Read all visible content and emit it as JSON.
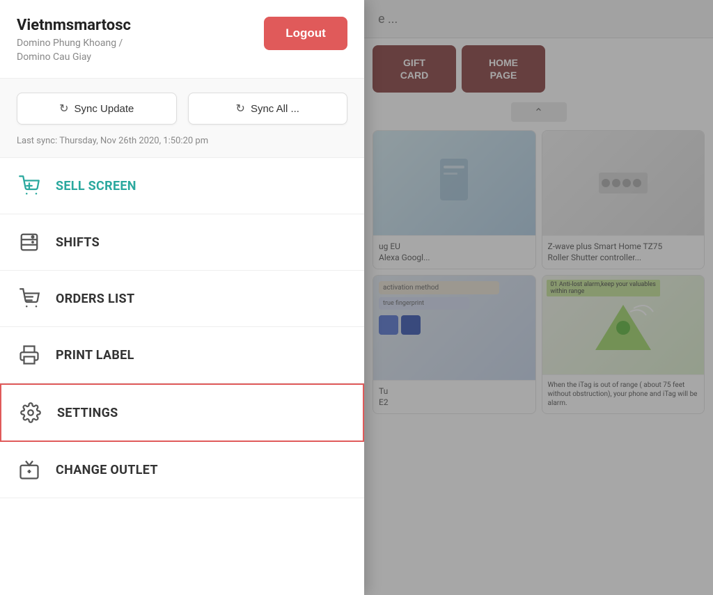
{
  "sidebar": {
    "username": "Vietnmsmartosc",
    "location_line1": "Domino Phung Khoang /",
    "location_line2": "Domino Cau Giay",
    "logout_label": "Logout",
    "sync": {
      "sync_update_label": "Sync Update",
      "sync_all_label": "Sync All ...",
      "last_sync_text": "Last sync: Thursday, Nov 26th 2020, 1:50:20 pm"
    },
    "menu_items": [
      {
        "id": "sell-screen",
        "label": "SELL SCREEN",
        "icon": "cart-plus-icon",
        "active": false
      },
      {
        "id": "shifts",
        "label": "SHIFTS",
        "icon": "shifts-icon",
        "active": false
      },
      {
        "id": "orders-list",
        "label": "ORDERS LIST",
        "icon": "orders-icon",
        "active": false
      },
      {
        "id": "print-label",
        "label": "PRINT LABEL",
        "icon": "print-icon",
        "active": false
      },
      {
        "id": "settings",
        "label": "SETTINGS",
        "icon": "settings-icon",
        "active": true
      },
      {
        "id": "change-outlet",
        "label": "CHANGE OUTLET",
        "icon": "outlet-icon",
        "active": false
      }
    ]
  },
  "background": {
    "topbar_text": "e ...",
    "categories": [
      {
        "label": "GIFT\nCARD"
      },
      {
        "label": "HOME\nPAGE"
      }
    ],
    "products": [
      {
        "name": "ug EU\nAlexa Googl..."
      },
      {
        "name": "Z-wave plus Smart Home TZ75\nRoller Shutter controller..."
      },
      {
        "name": "Tu\nE2"
      },
      {
        "name": "Anti-lost alarm,keep your valuables\nwithin range"
      }
    ]
  }
}
